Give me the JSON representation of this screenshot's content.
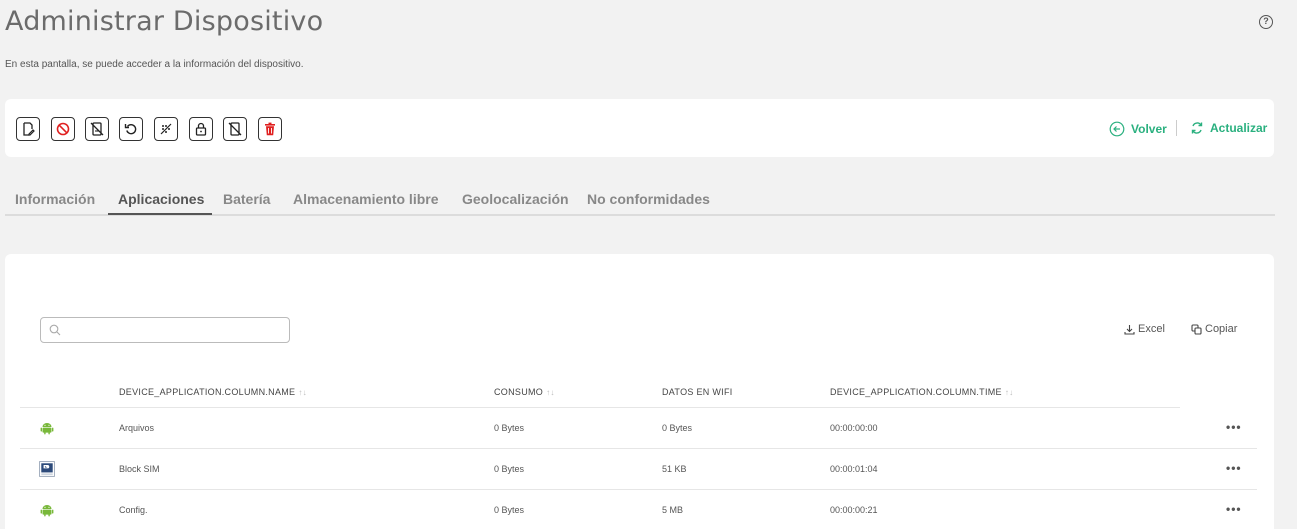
{
  "header": {
    "title": "Administrar Dispositivo",
    "subtitle": "En esta pantalla, se puede acceder a la información del dispositivo.",
    "help_icon": "question-circle-icon"
  },
  "toolbar": {
    "actions": [
      {
        "icon": "edit-document-icon"
      },
      {
        "icon": "block-icon"
      },
      {
        "icon": "wipe-device-icon"
      },
      {
        "icon": "reboot-icon"
      },
      {
        "icon": "clear-passcode-icon"
      },
      {
        "icon": "lock-icon"
      },
      {
        "icon": "disable-device-icon"
      },
      {
        "icon": "delete-icon"
      }
    ],
    "back_label": "Volver",
    "refresh_label": "Actualizar",
    "accent_color": "#2ab07f",
    "delete_color": "#e02020"
  },
  "tabs": {
    "items": [
      "Información",
      "Aplicaciones",
      "Batería",
      "Almacenamiento libre",
      "Geolocalización",
      "No conformidades"
    ],
    "active": "Aplicaciones"
  },
  "table": {
    "search_placeholder": "",
    "export_excel": "Excel",
    "export_copy": "Copiar",
    "columns": [
      "DEVICE_APPLICATION.COLUMN.NAME",
      "CONSUMO",
      "DATOS EN WIFI",
      "DEVICE_APPLICATION.COLUMN.TIME"
    ],
    "rows": [
      {
        "icon": "android-icon",
        "name": "Arquivos",
        "consumo": "0 Bytes",
        "wifi": "0 Bytes",
        "time": "00:00:00:00"
      },
      {
        "icon": "blocksim-app-icon",
        "name": "Block SIM",
        "consumo": "0 Bytes",
        "wifi": "51 KB",
        "time": "00:00:01:04"
      },
      {
        "icon": "android-icon",
        "name": "Config.",
        "consumo": "0 Bytes",
        "wifi": "5 MB",
        "time": "00:00:00:21"
      }
    ],
    "row_menu_icon": "more-horizontal-icon"
  }
}
